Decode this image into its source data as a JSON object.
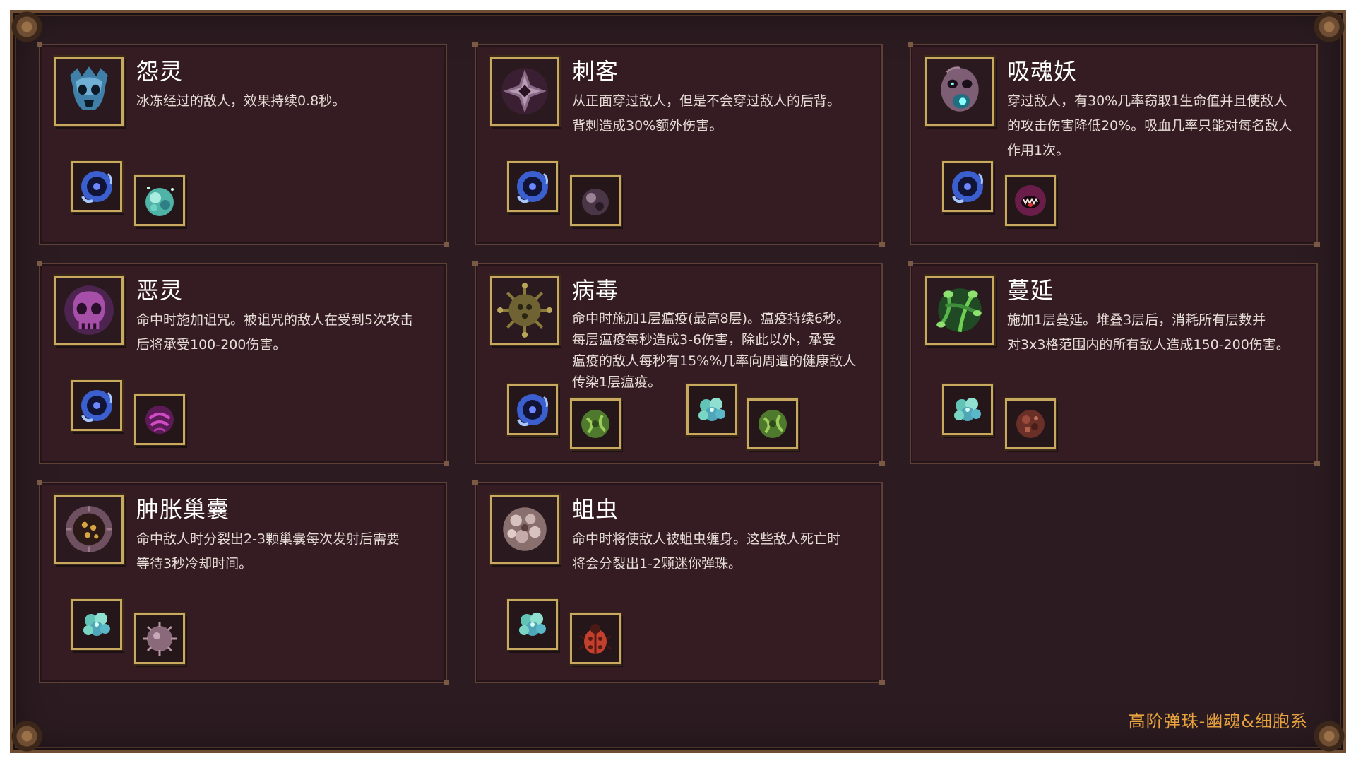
{
  "footer": "高阶弹珠-幽魂&细胞系",
  "cards": [
    {
      "title": "怨灵",
      "desc": [
        "冰冻经过的敌人，效果持续0.8秒。"
      ],
      "portrait": "ghost-skull-icon",
      "items": [
        "ghost-orb-icon",
        "frost-orb-icon"
      ]
    },
    {
      "title": "刺客",
      "desc": [
        "从正面穿过敌人，但是不会穿过敌人的后背。",
        "背刺造成30%额外伤害。"
      ],
      "portrait": "shuriken-icon",
      "items": [
        "ghost-orb-icon",
        "dark-orb-icon"
      ]
    },
    {
      "title": "吸魂妖",
      "desc": [
        "穿过敌人，有30%几率窃取1生命值并且使敌人",
        "的攻击伤害降低20%。吸血几率只能对每名敌人",
        "作用1次。"
      ],
      "portrait": "soul-sucker-icon",
      "items": [
        "ghost-orb-icon",
        "vampire-mouth-icon"
      ]
    },
    {
      "title": "恶灵",
      "desc": [
        "命中时施加诅咒。被诅咒的敌人在受到5次攻击",
        "后将承受100-200伤害。"
      ],
      "portrait": "purple-skull-icon",
      "items": [
        "ghost-orb-icon",
        "curse-orb-icon"
      ]
    },
    {
      "title": "病毒",
      "desc": [
        "命中时施加1层瘟疫(最高8层)。瘟疫持续6秒。",
        "每层瘟疫每秒造成3-6伤害，除此以外，承受",
        "瘟疫的敌人每秒有15%%几率向周遭的健康敌人",
        "传染1层瘟疫。"
      ],
      "portrait": "virus-icon",
      "items": [
        "ghost-orb-icon",
        "plague-orb-icon",
        "cell-orb-icon",
        "plague-orb-icon"
      ]
    },
    {
      "title": "蔓延",
      "desc": [
        "施加1层蔓延。堆叠3层后，消耗所有层数并",
        "对3x3格范围内的所有敌人造成150-200伤害。"
      ],
      "portrait": "vine-icon",
      "items": [
        "cell-orb-icon",
        "rust-orb-icon"
      ]
    },
    {
      "title": "肿胀巢囊",
      "desc": [
        "命中敌人时分裂出2-3颗巢囊每次发射后需要",
        "等待3秒冷却时间。"
      ],
      "portrait": "hive-sac-icon",
      "items": [
        "cell-orb-icon",
        "spore-orb-icon"
      ]
    },
    {
      "title": "蛆虫",
      "desc": [
        "命中时将使敌人被蛆虫缠身。这些敌人死亡时",
        "将会分裂出1-2颗迷你弹珠。"
      ],
      "portrait": "maggot-cluster-icon",
      "items": [
        "cell-orb-icon",
        "beetle-icon"
      ]
    }
  ]
}
